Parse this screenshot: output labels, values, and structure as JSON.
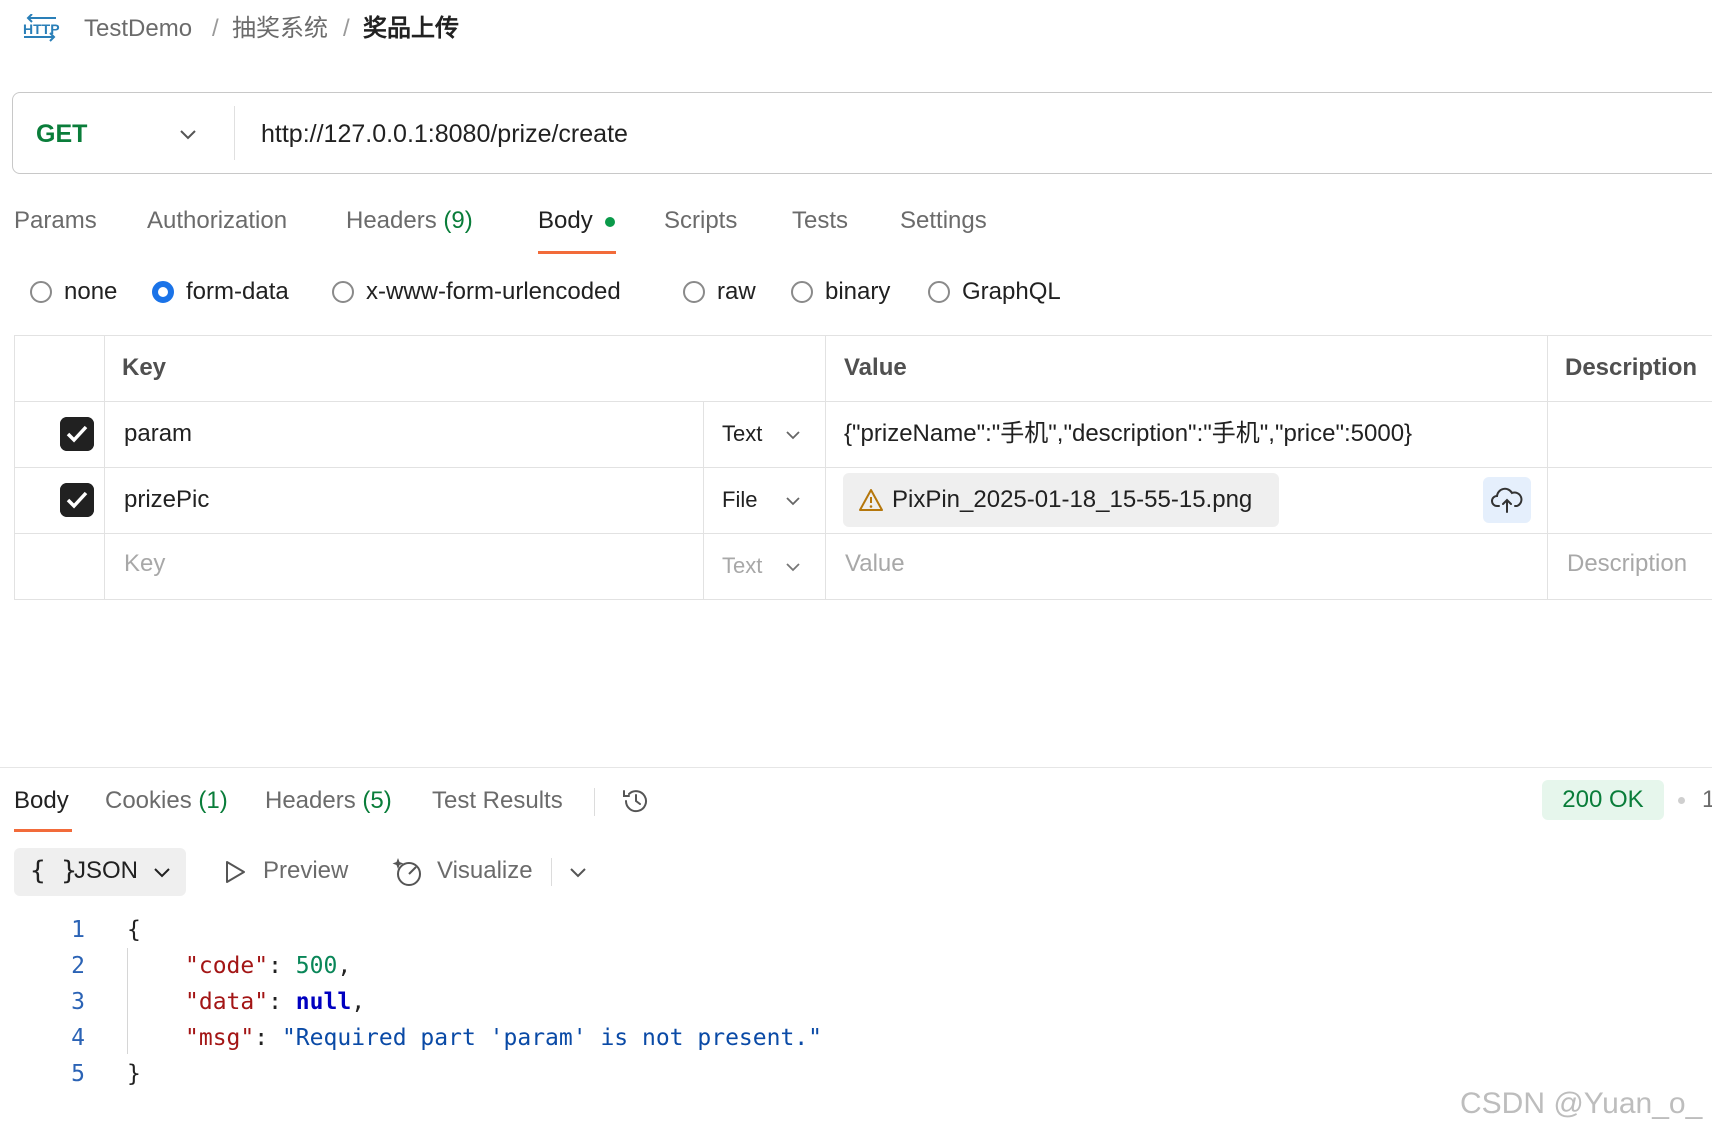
{
  "breadcrumb": {
    "icon_text": "HTTP",
    "items": [
      "TestDemo",
      "抽奖系统",
      "奖品上传"
    ],
    "separator": "/"
  },
  "request": {
    "method": "GET",
    "url": "http://127.0.0.1:8080/prize/create"
  },
  "request_tabs": [
    {
      "label": "Params"
    },
    {
      "label": "Authorization"
    },
    {
      "label": "Headers",
      "count": "(9)"
    },
    {
      "label": "Body",
      "active": true,
      "indicator_color": "#0a9a4a"
    },
    {
      "label": "Scripts"
    },
    {
      "label": "Tests"
    },
    {
      "label": "Settings"
    }
  ],
  "body_modes": [
    {
      "label": "none"
    },
    {
      "label": "form-data",
      "selected": true
    },
    {
      "label": "x-www-form-urlencoded"
    },
    {
      "label": "raw"
    },
    {
      "label": "binary"
    },
    {
      "label": "GraphQL"
    }
  ],
  "form_table": {
    "headers": {
      "key": "Key",
      "value": "Value",
      "description": "Description"
    },
    "rows": [
      {
        "checked": true,
        "key": "param",
        "type": "Text",
        "value": "{\"prizeName\":\"手机\",\"description\":\"手机\",\"price\":5000}"
      },
      {
        "checked": true,
        "key": "prizePic",
        "type": "File",
        "value": "PixPin_2025-01-18_15-55-15.png",
        "file_warning": true
      }
    ],
    "placeholder_row": {
      "key": "Key",
      "type": "Text",
      "value": "Value",
      "description": "Description"
    }
  },
  "response": {
    "tabs": [
      {
        "label": "Body",
        "active": true
      },
      {
        "label": "Cookies",
        "count": "(1)"
      },
      {
        "label": "Headers",
        "count": "(5)"
      },
      {
        "label": "Test Results"
      }
    ],
    "status": "200 OK",
    "status_extra": "1",
    "format": {
      "braces": "{ }",
      "label": "JSON"
    },
    "preview_label": "Preview",
    "visualize_label": "Visualize",
    "code_lines": [
      "1",
      "2",
      "3",
      "4",
      "5"
    ],
    "json": {
      "open": "{",
      "code_key": "\"code\"",
      "code_val": "500",
      "data_key": "\"data\"",
      "data_val": "null",
      "msg_key": "\"msg\"",
      "msg_val": "\"Required part 'param' is not present.\"",
      "close": "}"
    }
  },
  "watermark": "CSDN @Yuan_o_",
  "colors": {
    "accent_tab": "#f26b3a",
    "method_get": "#0a7d3a",
    "radio_selected": "#1a73e8",
    "status_ok_bg": "#e6f6ec"
  }
}
